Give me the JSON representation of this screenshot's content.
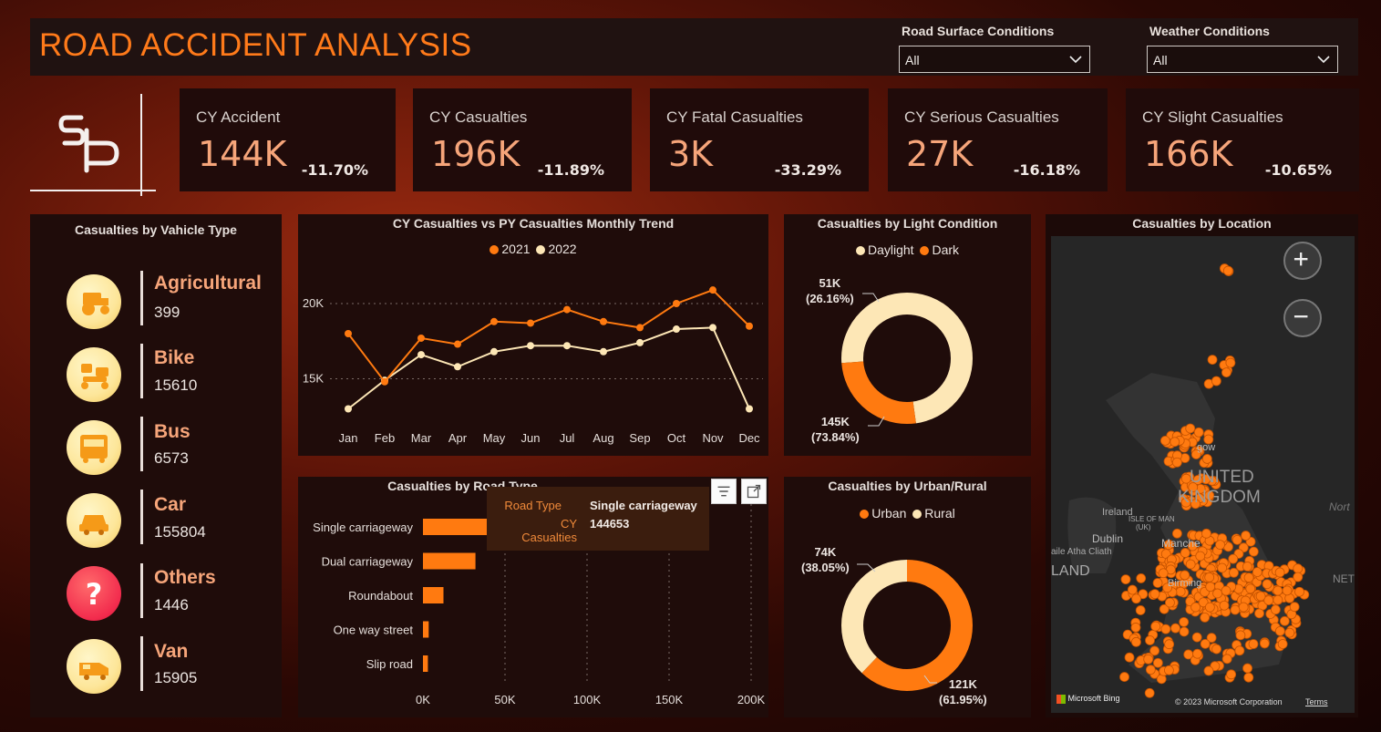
{
  "header": {
    "title": "ROAD ACCIDENT ANALYSIS",
    "filters": [
      {
        "label": "Road Surface Conditions",
        "value": "All"
      },
      {
        "label": "Weather Conditions",
        "value": "All"
      }
    ]
  },
  "kpis": [
    {
      "label": "CY Accident",
      "value": "144K",
      "change": "-11.70%"
    },
    {
      "label": "CY Casualties",
      "value": "196K",
      "change": "-11.89%"
    },
    {
      "label": "CY Fatal Casualties",
      "value": "3K",
      "change": "-33.29%"
    },
    {
      "label": "CY Serious Casualties",
      "value": "27K",
      "change": "-16.18%"
    },
    {
      "label": "CY Slight Casualties",
      "value": "166K",
      "change": "-10.65%"
    }
  ],
  "vehicles": {
    "title": "Casualties by Vahicle Type",
    "items": [
      {
        "name": "Agricultural",
        "value": "399",
        "icon": "tractor-icon"
      },
      {
        "name": "Bike",
        "value": "15610",
        "icon": "bike-icon"
      },
      {
        "name": "Bus",
        "value": "6573",
        "icon": "bus-icon"
      },
      {
        "name": "Car",
        "value": "155804",
        "icon": "car-icon"
      },
      {
        "name": "Others",
        "value": "1446",
        "icon": "question-icon"
      },
      {
        "name": "Van",
        "value": "15905",
        "icon": "van-icon"
      }
    ]
  },
  "colors": {
    "orange": "#ff7a10",
    "cream": "#fde7b6",
    "accent": "#ff7a1a"
  },
  "chart_data": [
    {
      "type": "line",
      "title": "CY Casualties vs PY Casualties Monthly Trend",
      "categories": [
        "Jan",
        "Feb",
        "Mar",
        "Apr",
        "May",
        "Jun",
        "Jul",
        "Aug",
        "Sep",
        "Oct",
        "Nov",
        "Dec"
      ],
      "series": [
        {
          "name": "2021",
          "values": [
            18000,
            14800,
            17700,
            17300,
            18800,
            18700,
            19600,
            18800,
            18400,
            20000,
            20900,
            18500
          ]
        },
        {
          "name": "2022",
          "values": [
            13000,
            14900,
            16600,
            15800,
            16800,
            17200,
            17200,
            16800,
            17400,
            18300,
            18400,
            13000
          ]
        }
      ],
      "yticks": [
        "15K",
        "20K"
      ],
      "ylim": [
        12000,
        22000
      ],
      "legend": "top-center"
    },
    {
      "type": "bar",
      "title": "Casualties by Road Type",
      "categories": [
        "Single carriageway",
        "Dual carriageway",
        "Roundabout",
        "One way street",
        "Slip road"
      ],
      "values": [
        144653,
        32000,
        12500,
        3500,
        3000
      ],
      "xticks": [
        "0K",
        "50K",
        "100K",
        "150K",
        "200K"
      ],
      "xlim": [
        0,
        200000
      ]
    },
    {
      "type": "pie",
      "title": "Casualties by Light Condition",
      "labels": [
        "Daylight",
        "Dark"
      ],
      "values": [
        145,
        51
      ],
      "display": [
        {
          "value": "145K",
          "pct": "(73.84%)"
        },
        {
          "value": "51K",
          "pct": "(26.16%)"
        }
      ]
    },
    {
      "type": "pie",
      "title": "Casualties by Urban/Rural",
      "labels": [
        "Urban",
        "Rural"
      ],
      "values": [
        121,
        74
      ],
      "display": [
        {
          "value": "121K",
          "pct": "(61.95%)"
        },
        {
          "value": "74K",
          "pct": "(38.05%)"
        }
      ]
    }
  ],
  "tooltip": {
    "key1": "Road Type",
    "val1": "Single carriageway",
    "key2": "CY Casualties",
    "val2": "144653"
  },
  "map": {
    "title": "Casualties by Location",
    "labels": {
      "uk1": "UNITED",
      "uk2": "KINGDOM",
      "ireland": "Ireland",
      "dublin": "Dublin",
      "land": "LAND",
      "iom": "ISLE OF MAN",
      "uk": "(UK)",
      "manche": "Manche",
      "birming": "Birming",
      "north": "Nort",
      "net": "NET",
      "atha": "aile Atha Cliath",
      "glasgow": "gow"
    },
    "bing": "Microsoft Bing",
    "copyright": "© 2023 Microsoft Corporation",
    "terms": "Terms"
  }
}
